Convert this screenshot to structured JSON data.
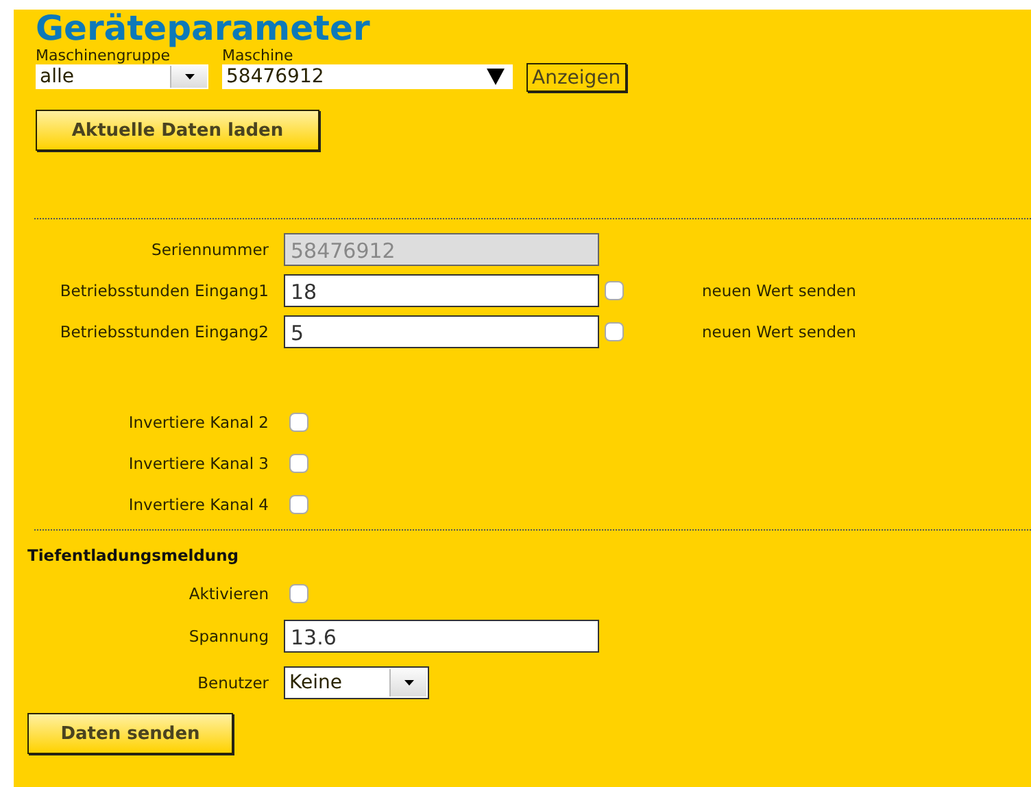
{
  "title": "Geräteparameter",
  "filters": {
    "group": {
      "label": "Maschinengruppe",
      "value": "alle"
    },
    "machine": {
      "label": "Maschine",
      "value": "58476912"
    },
    "show_button": "Anzeigen"
  },
  "load_button": "Aktuelle Daten laden",
  "parameters": [
    {
      "kind": "readonly",
      "label": "Seriennummer",
      "value": "58476912"
    },
    {
      "kind": "send",
      "label": "Betriebsstunden Eingang1",
      "value": "18",
      "checked": false,
      "note": "neuen Wert senden"
    },
    {
      "kind": "send",
      "label": "Betriebsstunden Eingang2",
      "value": "5",
      "checked": false,
      "note": "neuen Wert senden"
    }
  ],
  "channels": [
    {
      "label": "Invertiere Kanal 2",
      "checked": false
    },
    {
      "label": "Invertiere Kanal 3",
      "checked": false
    },
    {
      "label": "Invertiere Kanal 4",
      "checked": false
    }
  ],
  "alarm": {
    "title": "Tiefentladungsmeldung",
    "rows": [
      {
        "kind": "checkbox",
        "label": "Aktivieren",
        "checked": false
      },
      {
        "kind": "input",
        "label": "Spannung",
        "value": "13.6"
      },
      {
        "kind": "select",
        "label": "Benutzer",
        "value": "Keine"
      }
    ]
  },
  "send_button": "Daten senden"
}
